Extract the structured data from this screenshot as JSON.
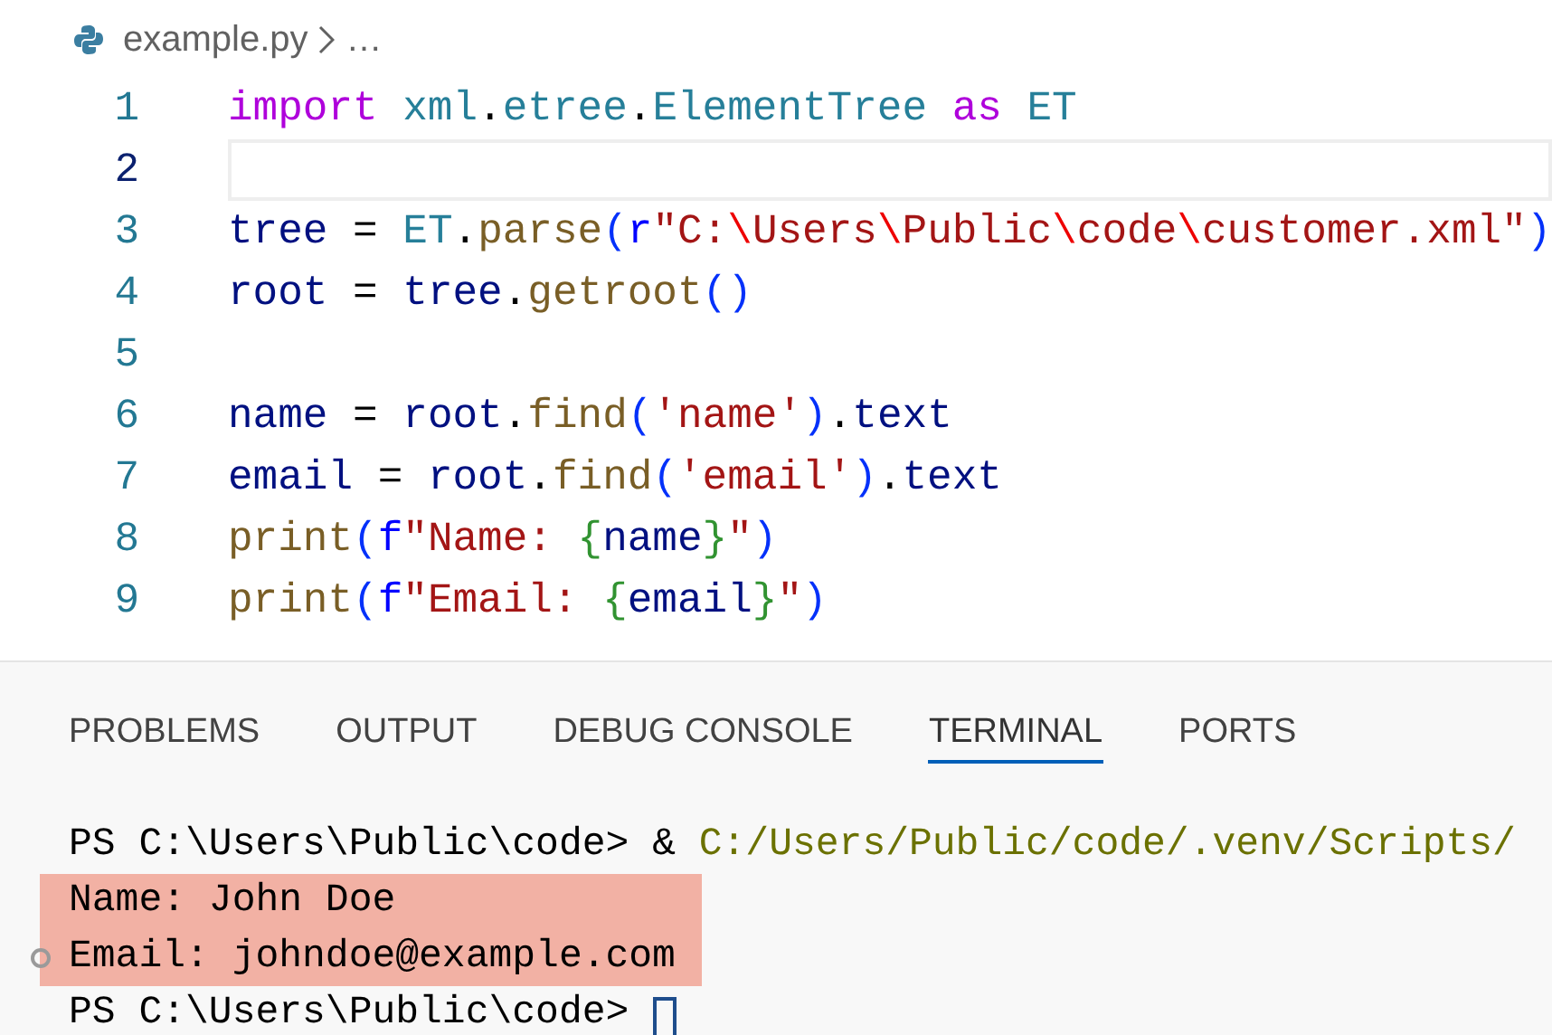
{
  "breadcrumb": {
    "file": "example.py",
    "more": "…"
  },
  "editor": {
    "lines": [
      {
        "number": "1",
        "current": false,
        "tokens": [
          {
            "kind": "keyword",
            "text": "import "
          },
          {
            "kind": "module",
            "text": "xml"
          },
          {
            "kind": "plain",
            "text": "."
          },
          {
            "kind": "module",
            "text": "etree"
          },
          {
            "kind": "plain",
            "text": "."
          },
          {
            "kind": "module",
            "text": "ElementTree "
          },
          {
            "kind": "keyword",
            "text": "as "
          },
          {
            "kind": "module",
            "text": "ET"
          }
        ]
      },
      {
        "number": "2",
        "current": true
      },
      {
        "number": "3",
        "current": false,
        "tokens": [
          {
            "kind": "variable",
            "text": "tree"
          },
          {
            "kind": "plain",
            "text": " = "
          },
          {
            "kind": "module",
            "text": "ET"
          },
          {
            "kind": "plain",
            "text": "."
          },
          {
            "kind": "function",
            "text": "parse"
          },
          {
            "kind": "paren",
            "text": "("
          },
          {
            "kind": "prefix",
            "text": "r"
          },
          {
            "kind": "string",
            "text": "\"C:"
          },
          {
            "kind": "escape",
            "text": "\\"
          },
          {
            "kind": "string",
            "text": "Users"
          },
          {
            "kind": "escape",
            "text": "\\"
          },
          {
            "kind": "string",
            "text": "Public"
          },
          {
            "kind": "escape",
            "text": "\\"
          },
          {
            "kind": "string",
            "text": "code"
          },
          {
            "kind": "escape",
            "text": "\\"
          },
          {
            "kind": "string",
            "text": "customer.xml\""
          },
          {
            "kind": "paren",
            "text": ")"
          }
        ]
      },
      {
        "number": "4",
        "current": false,
        "tokens": [
          {
            "kind": "variable",
            "text": "root"
          },
          {
            "kind": "plain",
            "text": " = "
          },
          {
            "kind": "variable",
            "text": "tree"
          },
          {
            "kind": "plain",
            "text": "."
          },
          {
            "kind": "function",
            "text": "getroot"
          },
          {
            "kind": "paren",
            "text": "()"
          }
        ]
      },
      {
        "number": "5",
        "current": false
      },
      {
        "number": "6",
        "current": false,
        "tokens": [
          {
            "kind": "variable",
            "text": "name"
          },
          {
            "kind": "plain",
            "text": " = "
          },
          {
            "kind": "variable",
            "text": "root"
          },
          {
            "kind": "plain",
            "text": "."
          },
          {
            "kind": "function",
            "text": "find"
          },
          {
            "kind": "paren",
            "text": "("
          },
          {
            "kind": "string",
            "text": "'name'"
          },
          {
            "kind": "paren",
            "text": ")"
          },
          {
            "kind": "plain",
            "text": "."
          },
          {
            "kind": "variable",
            "text": "text"
          }
        ]
      },
      {
        "number": "7",
        "current": false,
        "tokens": [
          {
            "kind": "variable",
            "text": "email"
          },
          {
            "kind": "plain",
            "text": " = "
          },
          {
            "kind": "variable",
            "text": "root"
          },
          {
            "kind": "plain",
            "text": "."
          },
          {
            "kind": "function",
            "text": "find"
          },
          {
            "kind": "paren",
            "text": "("
          },
          {
            "kind": "string",
            "text": "'email'"
          },
          {
            "kind": "paren",
            "text": ")"
          },
          {
            "kind": "plain",
            "text": "."
          },
          {
            "kind": "variable",
            "text": "text"
          }
        ]
      },
      {
        "number": "8",
        "current": false,
        "tokens": [
          {
            "kind": "function",
            "text": "print"
          },
          {
            "kind": "paren",
            "text": "("
          },
          {
            "kind": "prefix",
            "text": "f"
          },
          {
            "kind": "string",
            "text": "\"Name: "
          },
          {
            "kind": "brace",
            "text": "{"
          },
          {
            "kind": "variable",
            "text": "name"
          },
          {
            "kind": "brace",
            "text": "}"
          },
          {
            "kind": "string",
            "text": "\""
          },
          {
            "kind": "paren",
            "text": ")"
          }
        ]
      },
      {
        "number": "9",
        "current": false,
        "tokens": [
          {
            "kind": "function",
            "text": "print"
          },
          {
            "kind": "paren",
            "text": "("
          },
          {
            "kind": "prefix",
            "text": "f"
          },
          {
            "kind": "string",
            "text": "\"Email: "
          },
          {
            "kind": "brace",
            "text": "{"
          },
          {
            "kind": "variable",
            "text": "email"
          },
          {
            "kind": "brace",
            "text": "}"
          },
          {
            "kind": "string",
            "text": "\""
          },
          {
            "kind": "paren",
            "text": ")"
          }
        ]
      }
    ]
  },
  "panel": {
    "tabs": [
      {
        "label": "PROBLEMS",
        "selected": false
      },
      {
        "label": "OUTPUT",
        "selected": false
      },
      {
        "label": "DEBUG CONSOLE",
        "selected": false
      },
      {
        "label": "TERMINAL",
        "selected": true
      },
      {
        "label": "PORTS",
        "selected": false
      }
    ],
    "terminal": [
      {
        "highlighted": false,
        "marker": false,
        "cursor": false,
        "tokens": [
          {
            "kind": "plain",
            "text": "PS C:\\Users\\Public\\code> "
          },
          {
            "kind": "operator",
            "text": "& "
          },
          {
            "kind": "path",
            "text": "C:/Users/Public/code/.venv/Scripts/"
          }
        ]
      },
      {
        "highlighted": true,
        "marker": false,
        "cursor": false,
        "tokens": [
          {
            "kind": "plain",
            "text": "Name: John Doe"
          }
        ]
      },
      {
        "highlighted": true,
        "marker": true,
        "cursor": false,
        "tokens": [
          {
            "kind": "plain",
            "text": "Email: johndoe@example.com"
          }
        ]
      },
      {
        "highlighted": false,
        "marker": false,
        "cursor": true,
        "tokens": [
          {
            "kind": "plain",
            "text": "PS C:\\Users\\Public\\code> "
          }
        ]
      }
    ]
  }
}
